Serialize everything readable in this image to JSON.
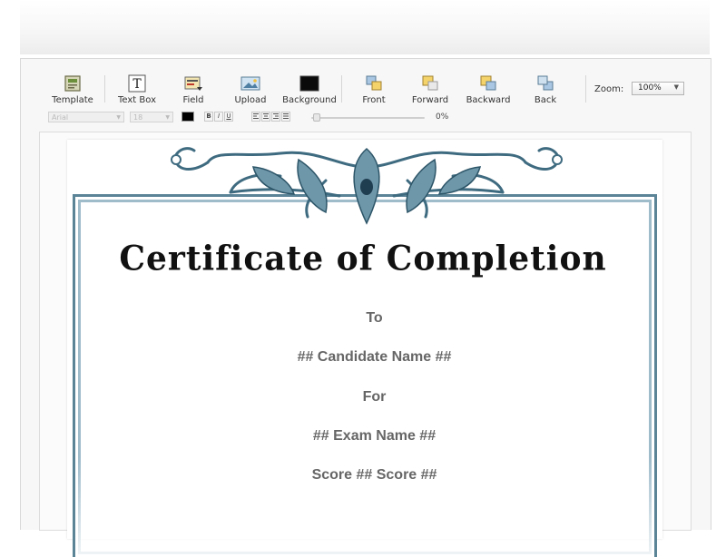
{
  "toolbar": {
    "tools": [
      {
        "label": "Template",
        "icon": "template-icon"
      },
      {
        "label": "Text Box",
        "icon": "text-box-icon"
      },
      {
        "label": "Field",
        "icon": "field-icon"
      },
      {
        "label": "Upload",
        "icon": "upload-image-icon"
      },
      {
        "label": "Background",
        "icon": "background-icon"
      },
      {
        "label": "Front",
        "icon": "bring-to-front-icon"
      },
      {
        "label": "Forward",
        "icon": "bring-forward-icon"
      },
      {
        "label": "Backward",
        "icon": "send-backward-icon"
      },
      {
        "label": "Back",
        "icon": "send-to-back-icon"
      }
    ],
    "zoom_label": "Zoom:",
    "zoom_value": "100%"
  },
  "format_bar": {
    "font_family": "Arial",
    "font_size": "18",
    "text_color": "#000000",
    "style_buttons": [
      "B",
      "I",
      "U"
    ],
    "align_buttons": [
      "align-left",
      "align-center",
      "align-right",
      "justify"
    ],
    "opacity_value": "0%"
  },
  "certificate": {
    "title": "Certificate of Completion",
    "line_to": "To",
    "candidate_placeholder": "## Candidate Name ##",
    "line_for": "For",
    "exam_placeholder": "## Exam Name ##",
    "score_line": "Score ## Score ##",
    "border_color": "#5b8497"
  }
}
